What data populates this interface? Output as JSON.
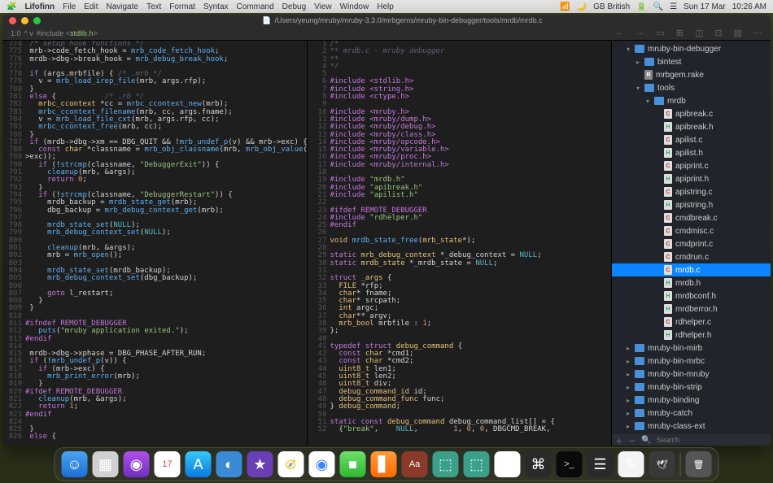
{
  "menubar": {
    "app": "Lifofinn",
    "items": [
      "File",
      "Edit",
      "Navigate",
      "Text",
      "Format",
      "Syntax",
      "Command",
      "Debug",
      "View",
      "Window",
      "Help"
    ],
    "right": {
      "lang": "GB British",
      "date": "Sun 17 Mar",
      "time": "10:26 AM"
    }
  },
  "titlebar": {
    "path": "/Users/yeung/mruby/mruby-3.3.0/mrbgems/mruby-bin-debugger/tools/mrdb/mrdb.c"
  },
  "toolbar": {
    "pos": "1:0",
    "arrows": "^ v",
    "crumb": "#include <",
    "crumb2": "stdlib.h",
    "crumb3": ">"
  },
  "left": {
    "start": 774,
    "lines": [
      {
        "c": " /* setup hook functions */"
      },
      {
        "t": " mrb->code_fetch_hook = <f>mrb_code_fetch_hook</f>;"
      },
      {
        "t": " mrdb->dbg->break_hook = <f>mrb_debug_break_hook</f>;"
      },
      {
        "t": ""
      },
      {
        "t": " <k>if</k> (args.mrbfile) { <c>/* .mrb */</c>"
      },
      {
        "t": "   v = <f>mrb_load_irep_file</f>(mrb, args.rfp);"
      },
      {
        "t": " }"
      },
      {
        "t": " <k>else</k> {           <c>/* .rb */</c>"
      },
      {
        "t": "   <t>mrbc_ccontext</t> *cc = <f>mrbc_ccontext_new</f>(mrb);"
      },
      {
        "t": "   <f>mrbc_ccontext_filename</f>(mrb, cc, args.fname);"
      },
      {
        "t": "   v = <f>mrb_load_file_cxt</f>(mrb, args.rfp, cc);"
      },
      {
        "t": "   <f>mrbc_ccontext_free</f>(mrb, cc);"
      },
      {
        "t": " }"
      },
      {
        "t": " <k>if</k> (mrdb->dbg->xm == DBG_QUIT && !<f>mrb_undef_p</f>(v) && mrb->exc) {"
      },
      {
        "t": "   <k>const</k> <t>char</t> *classname = <f>mrb_obj_classname</f>(mrb, <f>mrb_obj_value</f>(mrb-"
      },
      {
        "t": ">exc));"
      },
      {
        "t": "   <k>if</k> (!<f>strcmp</f>(classname, <s>\"DebuggerExit\"</s>)) {"
      },
      {
        "t": "     <f>cleanup</f>(mrb, &args);"
      },
      {
        "t": "     <k>return</k> <n>0</n>;"
      },
      {
        "t": "   }"
      },
      {
        "t": "   <k>if</k> (!<f>strcmp</f>(classname, <s>\"DebuggerRestart\"</s>)) {"
      },
      {
        "t": "     mrdb_backup = <f>mrdb_state_get</f>(mrb);"
      },
      {
        "t": "     dbg_backup = <f>mrb_debug_context_get</f>(mrb);"
      },
      {
        "t": ""
      },
      {
        "t": "     <f>mrdb_state_set</f>(<m>NULL</m>);"
      },
      {
        "t": "     <f>mrb_debug_context_set</f>(<m>NULL</m>);"
      },
      {
        "t": ""
      },
      {
        "t": "     <f>cleanup</f>(mrb, &args);"
      },
      {
        "t": "     mrb = <f>mrb_open</f>();"
      },
      {
        "t": ""
      },
      {
        "t": "     <f>mrdb_state_set</f>(mrdb_backup);"
      },
      {
        "t": "     <f>mrb_debug_context_set</f>(dbg_backup);"
      },
      {
        "t": ""
      },
      {
        "t": "     <k>goto</k> l_restart;"
      },
      {
        "t": "   }"
      },
      {
        "t": " }"
      },
      {
        "t": ""
      },
      {
        "p": "#ifndef REMOTE_DEBUGGER"
      },
      {
        "t": "   <f>puts</f>(<s>\"mruby application exited.\"</s>);"
      },
      {
        "p": "#endif"
      },
      {
        "t": ""
      },
      {
        "t": " mrdb->dbg->xphase = DBG_PHASE_AFTER_RUN;"
      },
      {
        "t": " <k>if</k> (!<f>mrb_undef_p</f>(v)) {"
      },
      {
        "t": "   <k>if</k> (mrb->exc) {"
      },
      {
        "t": "     <f>mrb_print_error</f>(mrb);"
      },
      {
        "t": "   }"
      },
      {
        "p": "#ifdef REMOTE_DEBUGGER"
      },
      {
        "t": "   <f>cleanup</f>(mrb, &args);"
      },
      {
        "t": "   <k>return</k> <n>1</n>;"
      },
      {
        "p": "#endif"
      },
      {
        "t": ""
      },
      {
        "t": " }"
      },
      {
        "t": " <k>else</k> {"
      }
    ]
  },
  "right": {
    "start": 1,
    "lines": [
      {
        "c": "/*"
      },
      {
        "c": "** mrdb.c - mruby debugger"
      },
      {
        "c": "**"
      },
      {
        "c": "*/"
      },
      {
        "t": ""
      },
      {
        "p": "#include <stdlib.h>"
      },
      {
        "p": "#include <string.h>"
      },
      {
        "p": "#include <ctype.h>"
      },
      {
        "t": ""
      },
      {
        "p": "#include <mruby.h>"
      },
      {
        "p": "#include <mruby/dump.h>"
      },
      {
        "p": "#include <mruby/debug.h>"
      },
      {
        "p": "#include <mruby/class.h>"
      },
      {
        "p": "#include <mruby/opcode.h>"
      },
      {
        "p": "#include <mruby/variable.h>"
      },
      {
        "p": "#include <mruby/proc.h>"
      },
      {
        "p": "#include <mruby/internal.h>"
      },
      {
        "t": ""
      },
      {
        "p": "#include \"mrdb.h\""
      },
      {
        "p": "#include \"apibreak.h\""
      },
      {
        "p": "#include \"apilist.h\""
      },
      {
        "t": ""
      },
      {
        "p": "#ifdef REMOTE_DEBUGGER"
      },
      {
        "p": "#include \"rdhelper.h\""
      },
      {
        "p": "#endif"
      },
      {
        "t": ""
      },
      {
        "t": "<t>void</t> <f>mrdb_state_free</f>(<t>mrb_state</t>*);"
      },
      {
        "t": ""
      },
      {
        "t": "<k>static</k> <t>mrb_debug_context</t> *_debug_context = <m>NULL</m>;"
      },
      {
        "t": "<k>static</k> <t>mrdb_state</t> *_mrdb_state = <m>NULL</m>;"
      },
      {
        "t": ""
      },
      {
        "t": "<k>struct</k> <t>_args</t> {"
      },
      {
        "t": "  <t>FILE</t> *rfp;"
      },
      {
        "t": "  <t>char</t>* fname;"
      },
      {
        "t": "  <t>char</t>* srcpath;"
      },
      {
        "t": "  <t>int</t> argc;"
      },
      {
        "t": "  <t>char</t>** argv;"
      },
      {
        "t": "  <t>mrb_bool</t> mrbfile : <n>1</n>;"
      },
      {
        "t": "};"
      },
      {
        "t": ""
      },
      {
        "t": "<k>typedef</k> <k>struct</k> <t>debug_command</t> {"
      },
      {
        "t": "  <k>const</k> <t>char</t> *cmd1;"
      },
      {
        "t": "  <k>const</k> <t>char</t> *cmd2;"
      },
      {
        "t": "  <t>uint8_t</t> len1;"
      },
      {
        "t": "  <t>uint8_t</t> len2;"
      },
      {
        "t": "  <t>uint8_t</t> div;"
      },
      {
        "t": "  <t>debug_command_id</t> id;"
      },
      {
        "t": "  <t>debug_command_func</t> func;"
      },
      {
        "t": "} <t>debug_command</t>;"
      },
      {
        "t": ""
      },
      {
        "t": "<k>static</k> <k>const</k> <t>debug_command</t> debug_command_list[] = {"
      },
      {
        "t": "  {<s>\"break\"</s>,    <m>NULL</m>,        <n>1</n>, <n>0</n>, <n>0</n>, DBGCMD_BREAK,"
      }
    ]
  },
  "tree": {
    "search_placeholder": "Search",
    "nodes": [
      {
        "d": 1,
        "open": true,
        "type": "folder",
        "name": "mruby-bin-debugger"
      },
      {
        "d": 2,
        "closed": true,
        "type": "folder",
        "name": "bintest"
      },
      {
        "d": 2,
        "type": "rake",
        "name": "mrbgem.rake"
      },
      {
        "d": 2,
        "open": true,
        "type": "folder",
        "name": "tools"
      },
      {
        "d": 3,
        "open": true,
        "type": "folder",
        "name": "mrdb"
      },
      {
        "d": 4,
        "type": "c",
        "name": "apibreak.c"
      },
      {
        "d": 4,
        "type": "h",
        "name": "apibreak.h"
      },
      {
        "d": 4,
        "type": "c",
        "name": "apilist.c"
      },
      {
        "d": 4,
        "type": "h",
        "name": "apilist.h"
      },
      {
        "d": 4,
        "type": "c",
        "name": "apiprint.c"
      },
      {
        "d": 4,
        "type": "h",
        "name": "apiprint.h"
      },
      {
        "d": 4,
        "type": "c",
        "name": "apistring.c"
      },
      {
        "d": 4,
        "type": "h",
        "name": "apistring.h"
      },
      {
        "d": 4,
        "type": "c",
        "name": "cmdbreak.c"
      },
      {
        "d": 4,
        "type": "c",
        "name": "cmdmisc.c"
      },
      {
        "d": 4,
        "type": "c",
        "name": "cmdprint.c"
      },
      {
        "d": 4,
        "type": "c",
        "name": "cmdrun.c"
      },
      {
        "d": 4,
        "type": "c",
        "name": "mrdb.c",
        "selected": true
      },
      {
        "d": 4,
        "type": "h",
        "name": "mrdb.h"
      },
      {
        "d": 4,
        "type": "h",
        "name": "mrdbconf.h"
      },
      {
        "d": 4,
        "type": "h",
        "name": "mrdberror.h"
      },
      {
        "d": 4,
        "type": "c",
        "name": "rdhelper.c"
      },
      {
        "d": 4,
        "type": "h",
        "name": "rdhelper.h"
      },
      {
        "d": 1,
        "closed": true,
        "type": "folder",
        "name": "mruby-bin-mirb"
      },
      {
        "d": 1,
        "closed": true,
        "type": "folder",
        "name": "mruby-bin-mrbc"
      },
      {
        "d": 1,
        "closed": true,
        "type": "folder",
        "name": "mruby-bin-mruby"
      },
      {
        "d": 1,
        "closed": true,
        "type": "folder",
        "name": "mruby-bin-strip"
      },
      {
        "d": 1,
        "closed": true,
        "type": "folder",
        "name": "mruby-binding"
      },
      {
        "d": 1,
        "closed": true,
        "type": "folder",
        "name": "mruby-catch"
      },
      {
        "d": 1,
        "closed": true,
        "type": "folder",
        "name": "mruby-class-ext"
      }
    ]
  },
  "dock": [
    {
      "name": "finder",
      "bg": "linear-gradient(#4aa3f0,#1b6fd6)",
      "glyph": "☺"
    },
    {
      "name": "launchpad",
      "bg": "#d0d0d0",
      "glyph": "▦"
    },
    {
      "name": "podcasts",
      "bg": "linear-gradient(#b050e8,#7030c0)",
      "glyph": "◉"
    },
    {
      "name": "calendar",
      "bg": "#fff",
      "glyph": "17",
      "text": "#e0453a"
    },
    {
      "name": "appstore",
      "bg": "linear-gradient(#35c8f7,#0a7be0)",
      "glyph": "A"
    },
    {
      "name": "app-blue",
      "bg": "#3a8ad6",
      "glyph": "◐"
    },
    {
      "name": "app-purple",
      "bg": "#6a3fb5",
      "glyph": "★"
    },
    {
      "name": "safari",
      "bg": "#fff",
      "glyph": "🧭"
    },
    {
      "name": "chrome",
      "bg": "#fff",
      "glyph": "◉",
      "text": "#4285f4"
    },
    {
      "name": "facetime",
      "bg": "linear-gradient(#6de06d,#2eb82e)",
      "glyph": "■"
    },
    {
      "name": "books",
      "bg": "linear-gradient(#ff9a3a,#ff6a00)",
      "glyph": "▋"
    },
    {
      "name": "dictionary",
      "bg": "#8b3a2a",
      "glyph": "Aa",
      "text": "#fff"
    },
    {
      "name": "mint1",
      "bg": "#3aa08a",
      "glyph": "⬚"
    },
    {
      "name": "mint2",
      "bg": "#3aa08a",
      "glyph": "⬚"
    },
    {
      "name": "photos",
      "bg": "#fff",
      "glyph": "✿"
    },
    {
      "name": "app-dark1",
      "bg": "#2a2a2a",
      "glyph": "⌘"
    },
    {
      "name": "terminal",
      "bg": "#0a0a0a",
      "glyph": ">_",
      "text": "#ddd"
    },
    {
      "name": "app-dark2",
      "bg": "#2a2a2a",
      "glyph": "☰"
    },
    {
      "name": "textedit",
      "bg": "#f4f4f4",
      "glyph": "✎"
    },
    {
      "name": "dove",
      "bg": "#3a3a3a",
      "glyph": "🕊"
    },
    {
      "name": "sep"
    },
    {
      "name": "trash",
      "bg": "#555",
      "glyph": "🗑"
    }
  ]
}
